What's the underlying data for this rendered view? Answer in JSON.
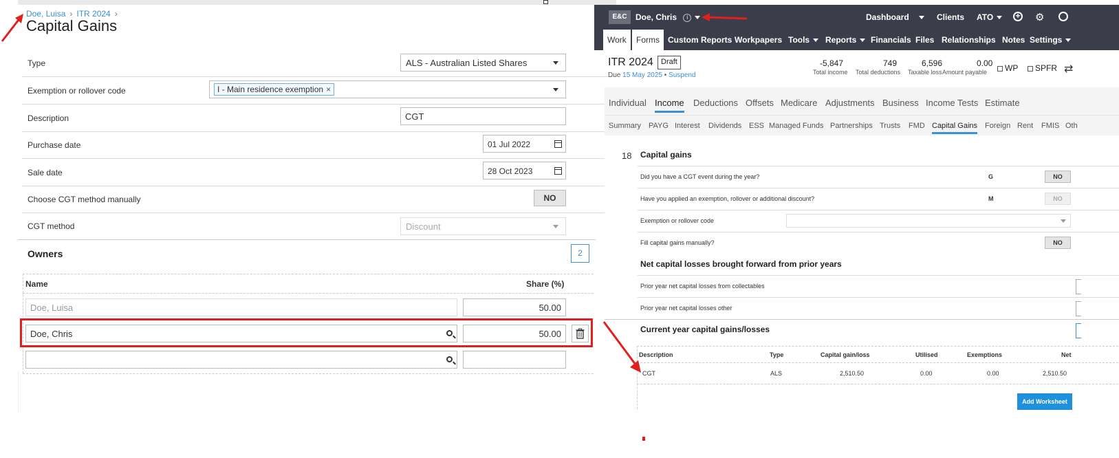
{
  "left": {
    "breadcrumb": [
      "Doe, Luisa",
      "ITR 2024"
    ],
    "title": "Capital Gains",
    "fields": {
      "type_label": "Type",
      "type_value": "ALS - Australian Listed Shares",
      "exemption_label": "Exemption or rollover code",
      "exemption_chip": "I - Main residence exemption",
      "description_label": "Description",
      "description_value": "CGT",
      "purchase_label": "Purchase date",
      "purchase_value": "01 Jul 2022",
      "sale_label": "Sale date",
      "sale_value": "28 Oct 2023",
      "manual_label": "Choose CGT method manually",
      "manual_value": "NO",
      "method_label": "CGT method",
      "method_value": "Discount"
    },
    "owners": {
      "label": "Owners",
      "count": "2",
      "col_name": "Name",
      "col_share": "Share (%)",
      "rows": [
        {
          "name": "Doe, Luisa",
          "share": "50.00"
        },
        {
          "name": "Doe, Chris",
          "share": "50.00"
        },
        {
          "name": "",
          "share": ""
        }
      ]
    }
  },
  "right": {
    "header": {
      "logo": "E&C",
      "client": "Doe, Chris",
      "nav": [
        "Dashboard",
        "Clients",
        "ATO"
      ]
    },
    "menu": [
      "Work",
      "Forms",
      "Custom Reports",
      "Workpapers",
      "Tools",
      "Reports",
      "Financials",
      "Files",
      "Relationships",
      "Notes",
      "Settings"
    ],
    "itr": {
      "title": "ITR 2024",
      "status": "Draft",
      "due_prefix": "Due",
      "due_date": "15 May 2025",
      "suspend": "Suspend",
      "stats": [
        {
          "value": "-5,847",
          "label": "Total income"
        },
        {
          "value": "749",
          "label": "Total deductions"
        },
        {
          "value": "6,596",
          "label": "Taxable loss"
        },
        {
          "value": "0.00",
          "label": "Amount payable"
        }
      ],
      "wp": "WP",
      "spfr": "SPFR"
    },
    "tabs": [
      "Individual",
      "Income",
      "Deductions",
      "Offsets",
      "Medicare",
      "Adjustments",
      "Business",
      "Income Tests",
      "Estimate"
    ],
    "subtabs": [
      "Summary",
      "PAYG",
      "Interest",
      "Dividends",
      "ESS",
      "Managed Funds",
      "Partnerships",
      "Trusts",
      "FMD",
      "Capital Gains",
      "Foreign",
      "Rent",
      "FMIS",
      "Oth"
    ],
    "section": {
      "number": "18",
      "title": "Capital gains",
      "q1": "Did you have a CGT event during the year?",
      "q1_code": "G",
      "q1_value": "NO",
      "q2": "Have you applied an exemption, rollover or additional discount?",
      "q2_code": "M",
      "q2_value": "NO",
      "q3": "Exemption or rollover code",
      "q4": "Fill capital gains manually?",
      "q4_value": "NO",
      "losses_title": "Net capital losses brought forward from prior years",
      "loss1": "Prior year net capital losses from collectables",
      "loss2": "Prior year net capital losses other",
      "current_title": "Current year capital gains/losses",
      "table_headers": [
        "Description",
        "Type",
        "Capital gain/loss",
        "Utilised",
        "Exemptions",
        "Net"
      ],
      "table_row": [
        "CGT",
        "ALS",
        "2,510.50",
        "0.00",
        "0.00",
        "2,510.50"
      ],
      "add_button": "Add Worksheet"
    }
  },
  "colors": {
    "accent": "#3b8fd6",
    "header_bg": "#3b3e4a",
    "highlight": "#e02020"
  }
}
